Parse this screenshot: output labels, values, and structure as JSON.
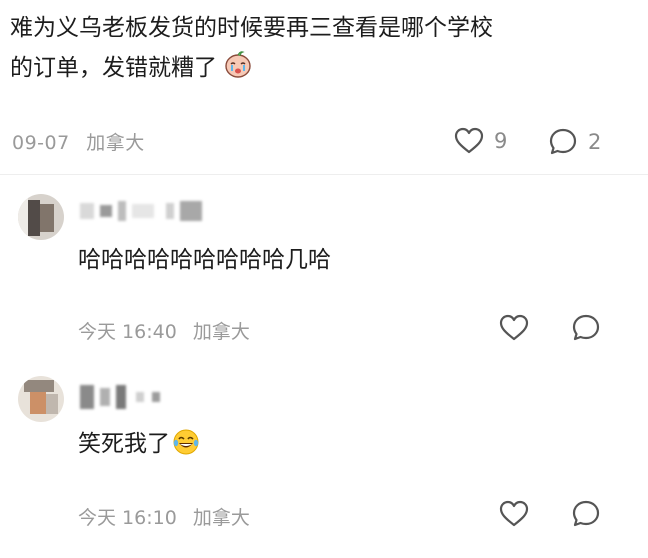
{
  "main_comment": {
    "line1": "难为义乌老板发货的时候要再三查看是哪个学校",
    "line2": "的订单，发错就糟了",
    "emoji": "crying-baby-emoji",
    "date": "09-07",
    "location": "加拿大",
    "likes": "9",
    "replies": "2"
  },
  "replies": [
    {
      "text": "哈哈哈哈哈哈哈哈哈几哈",
      "time": "今天 16:40",
      "location": "加拿大"
    },
    {
      "text": "笑死我了",
      "emoji": "laughing-tears-emoji",
      "time": "今天 16:10",
      "location": "加拿大"
    }
  ],
  "icons": {
    "like": "heart-icon",
    "comment": "comment-bubble-icon"
  },
  "colors": {
    "text": "#1d1d1d",
    "meta": "#9a9a9a",
    "icon": "#555555"
  }
}
